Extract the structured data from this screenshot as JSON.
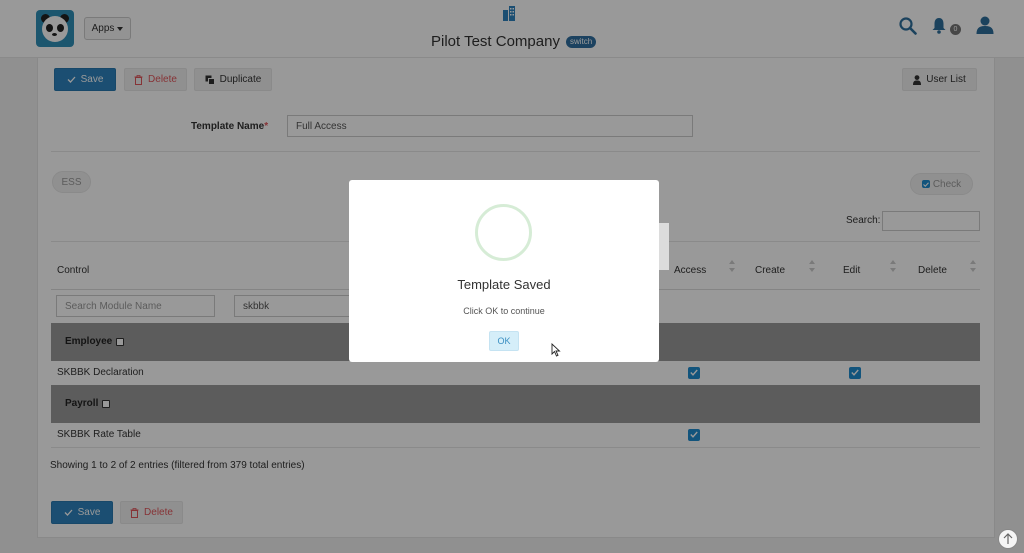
{
  "header": {
    "apps_label": "Apps",
    "company_name": "Pilot Test Company",
    "switch_label": "switch",
    "notification_count": "0"
  },
  "toolbar": {
    "save_label": "Save",
    "delete_label": "Delete",
    "duplicate_label": "Duplicate",
    "user_list_label": "User List"
  },
  "form": {
    "template_name_label": "Template Name",
    "required_mark": "*",
    "template_name_value": "Full Access"
  },
  "filters": {
    "ess_label": "ESS",
    "check_label": "Check",
    "search_label": "Search:",
    "search_value": ""
  },
  "table": {
    "columns": [
      "Control",
      "Access",
      "Create",
      "Edit",
      "Delete"
    ],
    "module_search_placeholder": "Search Module Name",
    "control_search_value": "skbbk",
    "groups": [
      {
        "name": "Employee",
        "rows": [
          {
            "label": "SKBBK Declaration",
            "access": true,
            "create": false,
            "edit": true,
            "delete": false
          }
        ]
      },
      {
        "name": "Payroll",
        "rows": [
          {
            "label": "SKBBK Rate Table",
            "access": true,
            "create": false,
            "edit": false,
            "delete": false
          }
        ]
      }
    ],
    "info": "Showing 1 to 2 of 2 entries (filtered from 379 total entries)"
  },
  "footer": {
    "save_label": "Save",
    "delete_label": "Delete"
  },
  "modal": {
    "title": "Template Saved",
    "message": "Click OK to continue",
    "ok_label": "OK"
  },
  "colors": {
    "primary": "#2d83bf",
    "danger": "#e0555a",
    "checkbox": "#1f8ccf",
    "group_row": "#999999"
  }
}
